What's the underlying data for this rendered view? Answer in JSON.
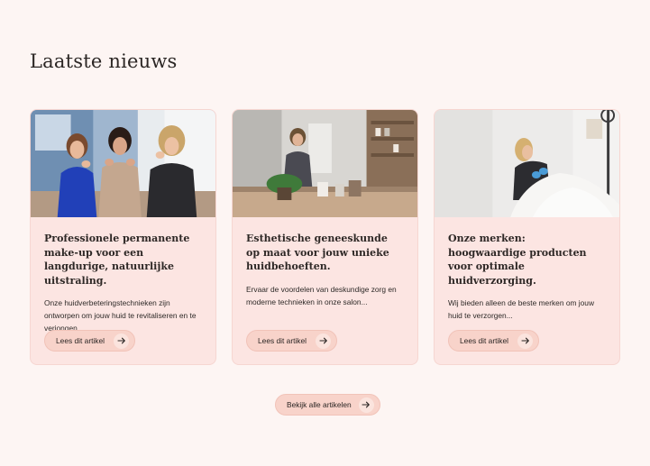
{
  "section": {
    "title": "Laatste nieuws"
  },
  "articles": [
    {
      "title": "Professionele permanente make-up voor een langdurige, natuurlijke uitstraling.",
      "excerpt": "Onze huidverbeteringstechnieken zijn ontworpen om jouw huid te revitaliseren en te verjongen...",
      "button": "Lees dit artikel"
    },
    {
      "title": "Esthetische geneeskunde op maat voor jouw unieke huidbehoeften.",
      "excerpt": "Ervaar de voordelen van deskundige zorg en moderne technieken in onze salon...",
      "button": "Lees dit artikel"
    },
    {
      "title": "Onze merken: hoogwaardige producten voor optimale huidverzorging.",
      "excerpt": "Wij bieden alleen de beste merken om jouw huid te verzorgen...",
      "button": "Lees dit artikel"
    }
  ],
  "view_all": {
    "label": "Bekijk alle artikelen"
  },
  "icons": {
    "button_arrow": "arrow-right-icon"
  },
  "colors": {
    "background": "#fdf5f3",
    "card": "#fce5e2",
    "button": "#f8d3ca"
  }
}
